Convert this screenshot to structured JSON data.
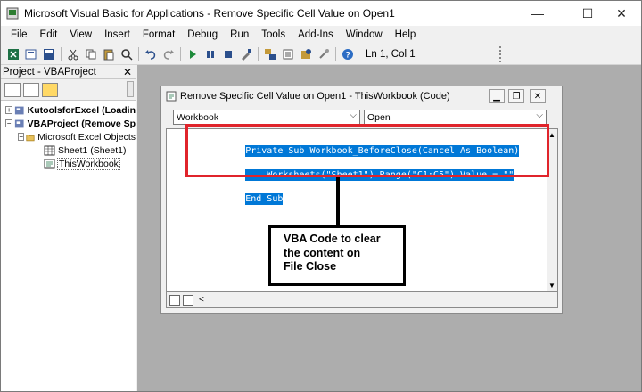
{
  "window": {
    "title": "Microsoft Visual Basic for Applications - Remove Specific Cell Value on Open1",
    "minimize_glyph": "—",
    "maximize_glyph": "☐",
    "close_glyph": "✕"
  },
  "menu": {
    "items": [
      "File",
      "Edit",
      "View",
      "Insert",
      "Format",
      "Debug",
      "Run",
      "Tools",
      "Add-Ins",
      "Window",
      "Help"
    ]
  },
  "toolbar": {
    "position_text": "Ln 1, Col 1",
    "icons": [
      "excel-icon",
      "insert-module-icon",
      "save-icon",
      "cut-icon",
      "copy-icon",
      "paste-icon",
      "find-icon",
      "undo-icon",
      "redo-icon",
      "run-icon",
      "break-icon",
      "reset-icon",
      "design-mode-icon",
      "project-explorer-icon",
      "properties-icon",
      "object-browser-icon",
      "toolbox-icon",
      "help-icon"
    ]
  },
  "project": {
    "title": "Project - VBAProject",
    "tree": [
      {
        "label": "KutoolsforExcel (Loadin",
        "bold": true,
        "expander": "+"
      },
      {
        "label": "VBAProject (Remove Sp",
        "bold": true,
        "expander": "−"
      },
      {
        "label": "Microsoft Excel Objects",
        "bold": false,
        "expander": "−"
      },
      {
        "label": "Sheet1 (Sheet1)",
        "bold": false,
        "expander": ""
      },
      {
        "label": "ThisWorkbook",
        "bold": false,
        "expander": ""
      }
    ]
  },
  "code_window": {
    "title": "Remove Specific Cell Value on Open1 - ThisWorkbook (Code)",
    "object_combo": "Workbook",
    "procedure_combo": "Open",
    "lines": [
      "Private Sub Workbook_BeforeClose(Cancel As Boolean)",
      "    Worksheets(\"Sheet1\").Range(\"C1:C5\").Value = \"\"",
      "End Sub"
    ]
  },
  "annotation": {
    "text": "VBA Code to clear the content on File Close",
    "lines": [
      "VBA Code to clear",
      "the content on",
      "File Close"
    ],
    "highlight_color": "#e0242b"
  },
  "colors": {
    "selection": "#0078d7",
    "mdi_background": "#adadad"
  }
}
